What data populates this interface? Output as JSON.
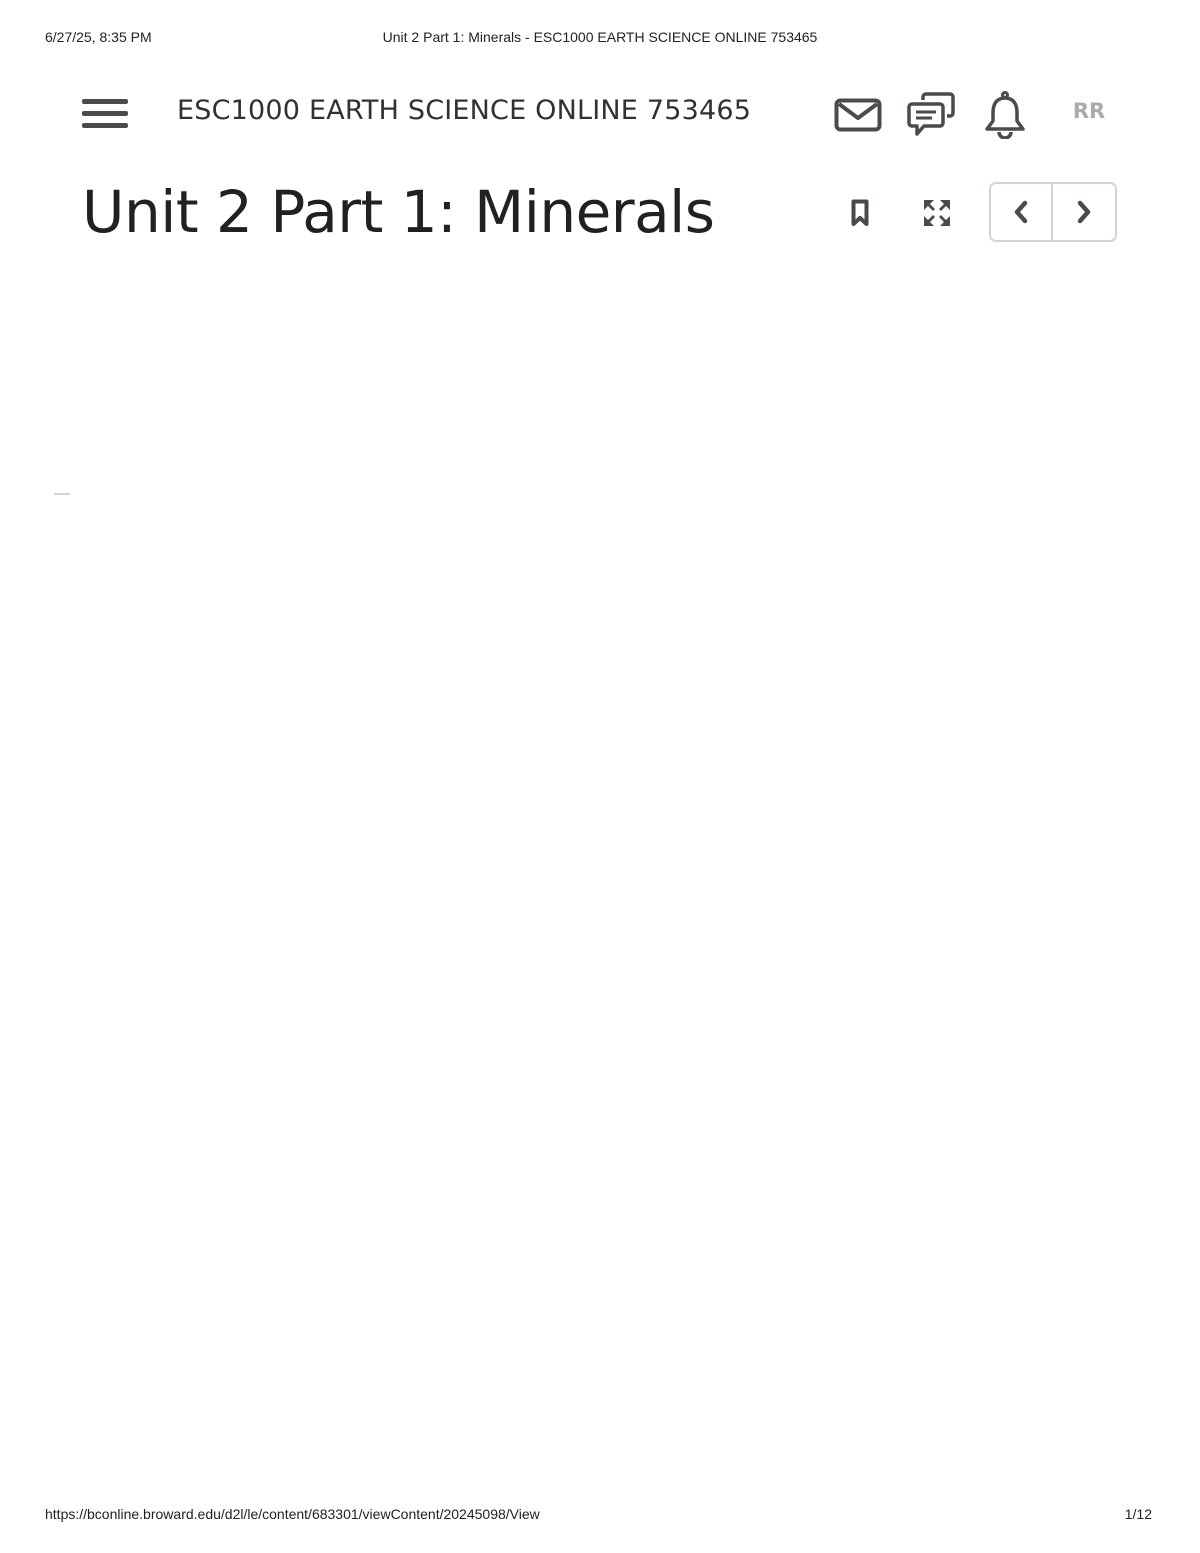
{
  "print_header": {
    "datetime": "6/27/25, 8:35 PM",
    "document_title": "Unit 2 Part 1: Minerals - ESC1000 EARTH SCIENCE ONLINE 753465"
  },
  "navbar": {
    "menu_icon": "hamburger-menu-icon",
    "course_title": "ESC1000 EARTH SCIENCE ONLINE 753465",
    "icons": [
      "mail-icon",
      "chat-icon",
      "bell-icon"
    ],
    "avatar_initials": "RR"
  },
  "content": {
    "page_title": "Unit 2 Part 1: Minerals",
    "tools": [
      "bookmark-icon",
      "fullscreen-icon"
    ],
    "pager": {
      "prev_icon": "chevron-left-icon",
      "next_icon": "chevron-right-icon"
    }
  },
  "print_footer": {
    "url": "https://bconline.broward.edu/d2l/le/content/683301/viewContent/20245098/View",
    "page_indicator": "1/12"
  },
  "colors": {
    "icon": "#494c4e",
    "title": "#202122",
    "avatar_text": "#a9abad",
    "pager_border": "#cdd5dc"
  }
}
